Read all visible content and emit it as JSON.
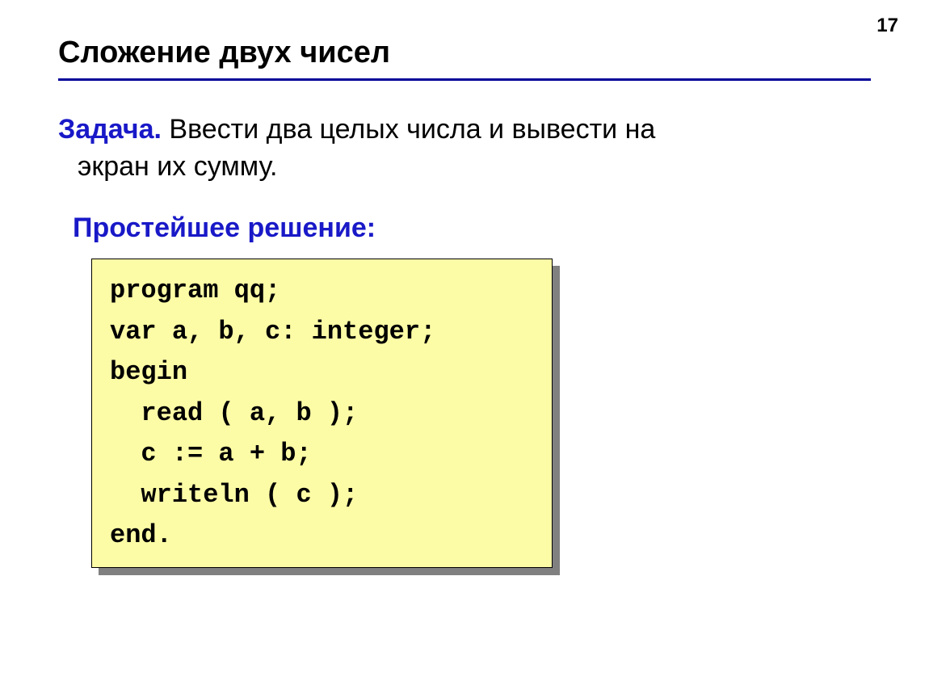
{
  "page_number": "17",
  "title": "Сложение двух чисел",
  "task_label": "Задача.",
  "task_text_line1_rest": " Ввести два целых числа и вывести на",
  "task_text_line2": "экран их сумму.",
  "solution_label": "Простейшее  решение:",
  "code": {
    "line1": "program qq;",
    "line2": "var a, b, c: integer;",
    "line3": "begin",
    "line4": "  read ( a, b );",
    "line5": "  c := a + b;",
    "line6": "  writeln ( c );",
    "line7": "end."
  }
}
